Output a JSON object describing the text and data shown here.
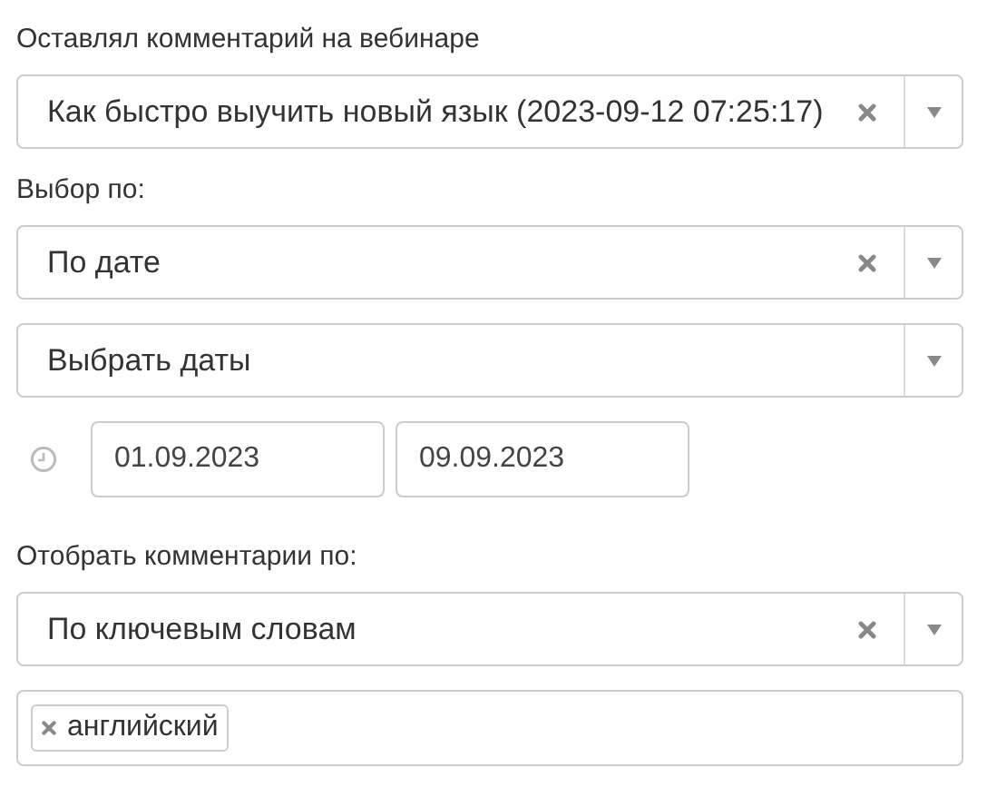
{
  "sections": [
    {
      "kind": "select",
      "label": "Оставлял комментарий на вебинаре",
      "value": "Как быстро выучить новый язык (2023-09-12 07:25:17)",
      "clearable": true
    },
    {
      "kind": "select",
      "label": "Выбор по:",
      "value": "По дате",
      "clearable": true
    },
    {
      "kind": "select",
      "value": "Выбрать даты",
      "clearable": false
    },
    {
      "kind": "dates",
      "from": "01.09.2023",
      "to": "09.09.2023"
    },
    {
      "kind": "select",
      "label": "Отобрать комментарии по:",
      "value": "По ключевым словам",
      "clearable": true
    },
    {
      "kind": "tags",
      "tags": [
        "английский"
      ]
    }
  ]
}
